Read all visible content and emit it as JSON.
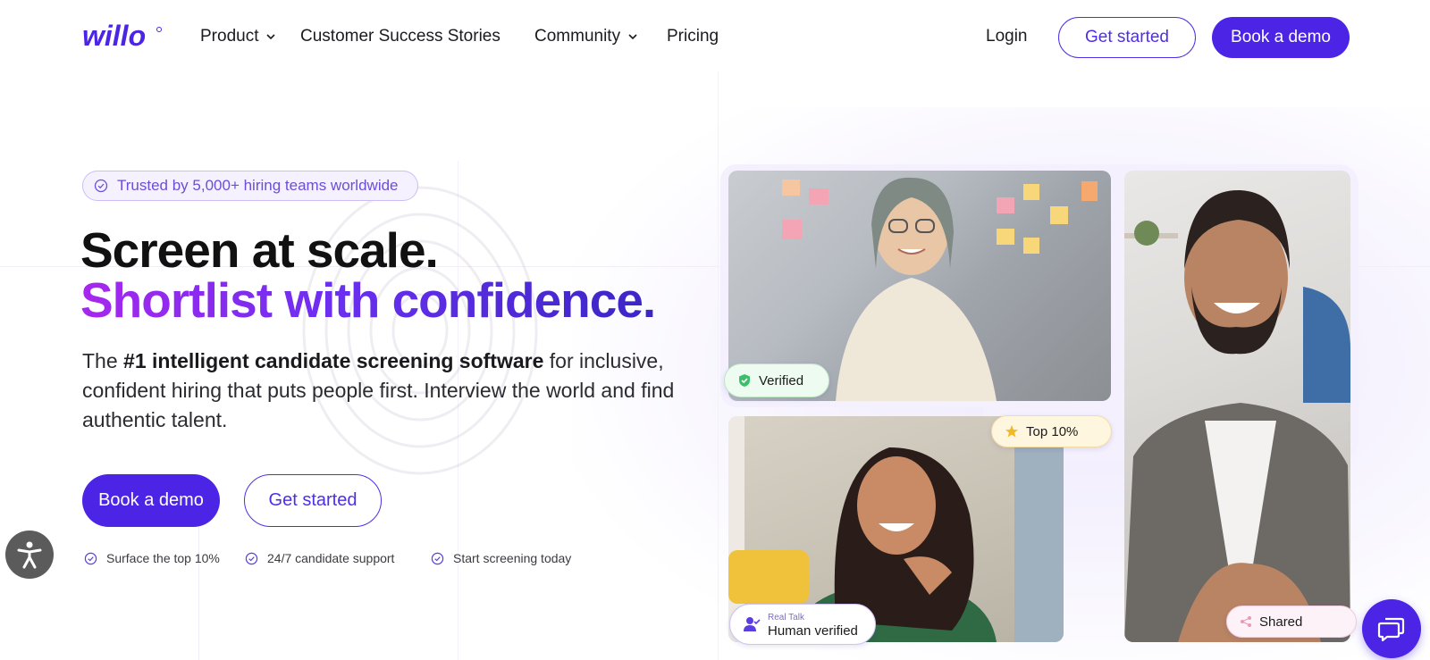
{
  "brand": {
    "logo_text": "willo",
    "accent": "#4b24e6",
    "gradient": [
      "#a727ee",
      "#6a2ff0",
      "#3a26c4"
    ]
  },
  "nav": {
    "links": [
      {
        "label": "Product",
        "dropdown": true
      },
      {
        "label": "Customer Success Stories",
        "dropdown": false
      },
      {
        "label": "Community",
        "dropdown": true
      },
      {
        "label": "Pricing",
        "dropdown": false
      }
    ],
    "login_label": "Login",
    "get_started_label": "Get started",
    "book_demo_label": "Book a demo"
  },
  "hero": {
    "trusted_badge": "Trusted by 5,000+ hiring teams worldwide",
    "headline_line1": "Screen at scale.",
    "headline_line2": "Shortlist with confidence.",
    "desc_prefix": "The ",
    "desc_bold": "#1 intelligent candidate screening software",
    "desc_suffix": " for inclusive, confident hiring that puts people first. Interview the world and find authentic talent.",
    "book_demo_label": "Book a demo",
    "get_started_label": "Get started",
    "checks": [
      "Surface the top 10%",
      "24/7 candidate support",
      "Start screening today"
    ]
  },
  "collage": {
    "badges": {
      "verified": "Verified",
      "top": "Top 10%",
      "human_small": "Real Talk",
      "human_big": "Human verified",
      "shared": "Shared"
    }
  },
  "icons": {
    "accessibility": "accessibility-icon",
    "chat": "chat-icon",
    "check": "check-circle-icon",
    "chevron": "chevron-down-icon"
  }
}
